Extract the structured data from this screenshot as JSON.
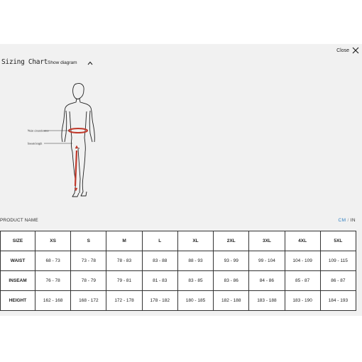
{
  "header": {
    "title": "Sizing Chart",
    "toggle_label": "Show diagram",
    "close_label": "Close"
  },
  "diagram": {
    "labels": {
      "waist": "Waist circumference",
      "inseam": "Inseam length"
    },
    "accent_color": "#c0392b"
  },
  "product_name": "PRODUCT NAME",
  "units": {
    "cm": "CM",
    "separator": "/",
    "in": "IN",
    "active": "CM",
    "active_color": "#2f7fc1"
  },
  "table": {
    "header": [
      "SIZE",
      "XS",
      "S",
      "M",
      "L",
      "XL",
      "2XL",
      "3XL",
      "4XL",
      "5XL"
    ],
    "rows": [
      [
        "WAIST",
        "68 - 73",
        "73 - 78",
        "78 - 83",
        "83 - 88",
        "88 - 93",
        "93 - 99",
        "99 - 104",
        "104 - 109",
        "109 - 115"
      ],
      [
        "INSEAM",
        "76 - 78",
        "78 - 79",
        "79 - 81",
        "81 - 83",
        "83 - 85",
        "83 - 86",
        "84 - 86",
        "85 - 87",
        "86 - 87"
      ],
      [
        "HEIGHT",
        "162 - 168",
        "168 - 172",
        "172 - 178",
        "178 - 182",
        "180 - 185",
        "182 - 188",
        "183 - 188",
        "183 - 190",
        "184 - 193"
      ]
    ]
  }
}
